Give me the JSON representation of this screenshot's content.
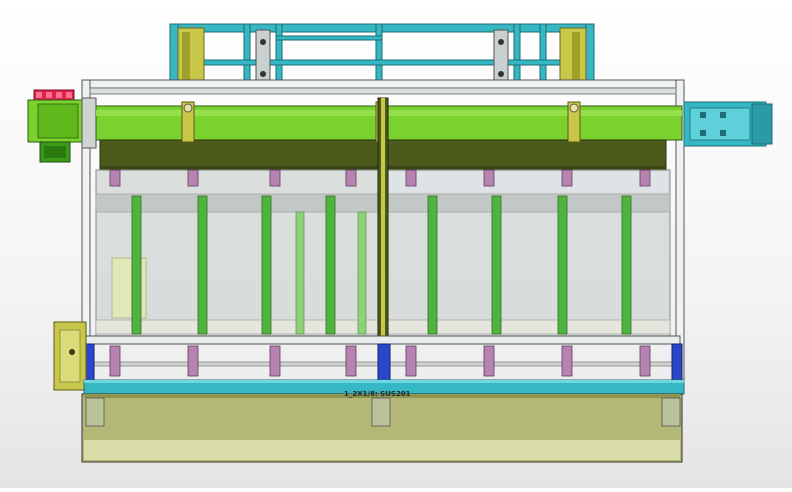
{
  "drawing": {
    "bottom_label": "1_2X1/8: SUS201"
  },
  "colors": {
    "cyan_frame": "#35b7c4",
    "green_beam": "#7bd12e",
    "dark_olive": "#4c5a1c",
    "olive_body": "#b4b877",
    "post_green": "#4fb33f",
    "red_unit": "#e0204d",
    "panel_gray": "#cfd4d1",
    "clamp": "#b784b2",
    "blue_block": "#2a47c9",
    "yellow_block": "#c9c74a"
  }
}
